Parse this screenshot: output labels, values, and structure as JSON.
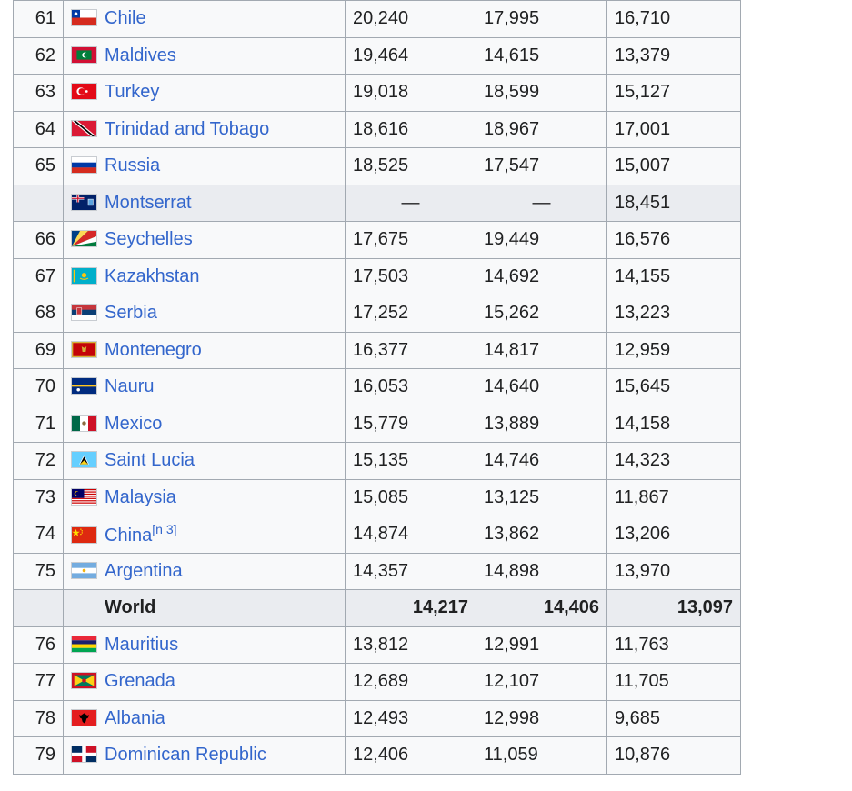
{
  "rows": [
    {
      "rank": "61",
      "country": "Chile",
      "flag": "chile-flag-icon",
      "v1": "20,240",
      "v2": "17,995",
      "v3": "16,710"
    },
    {
      "rank": "62",
      "country": "Maldives",
      "flag": "maldives-flag-icon",
      "v1": "19,464",
      "v2": "14,615",
      "v3": "13,379"
    },
    {
      "rank": "63",
      "country": "Turkey",
      "flag": "turkey-flag-icon",
      "v1": "19,018",
      "v2": "18,599",
      "v3": "15,127"
    },
    {
      "rank": "64",
      "country": "Trinidad and Tobago",
      "flag": "trinidad-and-tobago-flag-icon",
      "v1": "18,616",
      "v2": "18,967",
      "v3": "17,001"
    },
    {
      "rank": "65",
      "country": "Russia",
      "flag": "russia-flag-icon",
      "v1": "18,525",
      "v2": "17,547",
      "v3": "15,007"
    },
    {
      "rank": "",
      "country": "Montserrat",
      "flag": "montserrat-flag-icon",
      "v1": "—",
      "v2": "—",
      "v3": "18,451"
    },
    {
      "rank": "66",
      "country": "Seychelles",
      "flag": "seychelles-flag-icon",
      "v1": "17,675",
      "v2": "19,449",
      "v3": "16,576"
    },
    {
      "rank": "67",
      "country": "Kazakhstan",
      "flag": "kazakhstan-flag-icon",
      "v1": "17,503",
      "v2": "14,692",
      "v3": "14,155"
    },
    {
      "rank": "68",
      "country": "Serbia",
      "flag": "serbia-flag-icon",
      "v1": "17,252",
      "v2": "15,262",
      "v3": "13,223"
    },
    {
      "rank": "69",
      "country": "Montenegro",
      "flag": "montenegro-flag-icon",
      "v1": "16,377",
      "v2": "14,817",
      "v3": "12,959"
    },
    {
      "rank": "70",
      "country": "Nauru",
      "flag": "nauru-flag-icon",
      "v1": "16,053",
      "v2": "14,640",
      "v3": "15,645"
    },
    {
      "rank": "71",
      "country": "Mexico",
      "flag": "mexico-flag-icon",
      "v1": "15,779",
      "v2": "13,889",
      "v3": "14,158"
    },
    {
      "rank": "72",
      "country": "Saint Lucia",
      "flag": "saint-lucia-flag-icon",
      "v1": "15,135",
      "v2": "14,746",
      "v3": "14,323"
    },
    {
      "rank": "73",
      "country": "Malaysia",
      "flag": "malaysia-flag-icon",
      "v1": "15,085",
      "v2": "13,125",
      "v3": "11,867"
    },
    {
      "rank": "74",
      "country": "China",
      "note": "[n 3]",
      "flag": "china-flag-icon",
      "v1": "14,874",
      "v2": "13,862",
      "v3": "13,206"
    },
    {
      "rank": "75",
      "country": "Argentina",
      "flag": "argentina-flag-icon",
      "v1": "14,357",
      "v2": "14,898",
      "v3": "13,970"
    },
    {
      "rank": "",
      "country": "World",
      "flag": "",
      "v1": "14,217",
      "v2": "14,406",
      "v3": "13,097"
    },
    {
      "rank": "76",
      "country": "Mauritius",
      "flag": "mauritius-flag-icon",
      "v1": "13,812",
      "v2": "12,991",
      "v3": "11,763"
    },
    {
      "rank": "77",
      "country": "Grenada",
      "flag": "grenada-flag-icon",
      "v1": "12,689",
      "v2": "12,107",
      "v3": "11,705"
    },
    {
      "rank": "78",
      "country": "Albania",
      "flag": "albania-flag-icon",
      "v1": "12,493",
      "v2": "12,998",
      "v3": "9,685"
    },
    {
      "rank": "79",
      "country": "Dominican Republic",
      "flag": "dominican-republic-flag-icon",
      "v1": "12,406",
      "v2": "11,059",
      "v3": "10,876"
    }
  ],
  "colors": {
    "link": "#3366cc",
    "cell_bg": "#f8f9fa",
    "highlight_bg": "#eaecf0",
    "border": "#a2a9b1"
  }
}
